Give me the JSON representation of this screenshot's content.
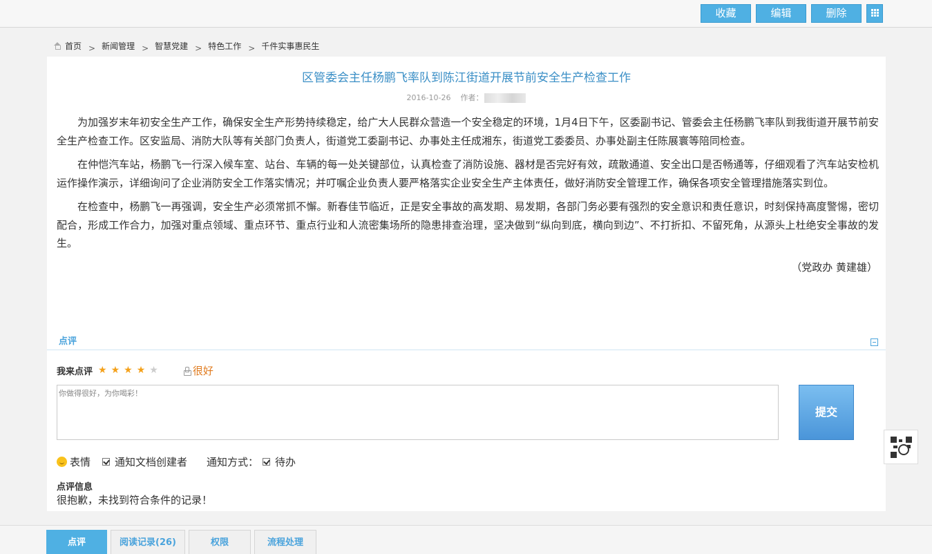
{
  "toolbar": {
    "favorite_label": "收藏",
    "edit_label": "编辑",
    "delete_label": "删除",
    "color_accent": "#4fb0e3"
  },
  "breadcrumb": {
    "items": [
      "首页",
      "新闻管理",
      "智慧党建",
      "特色工作",
      "千件实事惠民生"
    ],
    "separator": ">"
  },
  "article": {
    "title": "区管委会主任杨鹏飞率队到陈江街道开展节前安全生产检查工作",
    "date": "2016-10-26",
    "author_label": "作者：",
    "paragraphs": [
      "为加强岁末年初安全生产工作，确保安全生产形势持续稳定，给广大人民群众营造一个安全稳定的环境，1月4日下午，区委副书记、管委会主任杨鹏飞率队到我街道开展节前安全生产检查工作。区安监局、消防大队等有关部门负责人，街道党工委副书记、办事处主任成湘东，街道党工委委员、办事处副主任陈展寰等陪同检查。",
      "在仲恺汽车站，杨鹏飞一行深入候车室、站台、车辆的每一处关键部位，认真检查了消防设施、器材是否完好有效，疏散通道、安全出口是否畅通等，仔细观看了汽车站安检机运作操作演示，详细询问了企业消防安全工作落实情况；并叮嘱企业负责人要严格落实企业安全生产主体责任，做好消防安全管理工作，确保各项安全管理措施落实到位。",
      "在检查中，杨鹏飞一再强调，安全生产必须常抓不懈。新春佳节临近，正是安全事故的高发期、易发期，各部门务必要有强烈的安全意识和责任意识，时刻保持高度警惕，密切配合，形成工作合力，加强对重点领域、重点环节、重点行业和人流密集场所的隐患排查治理，坚决做到“纵向到底，横向到边”、不打折扣、不留死角，从源头上杜绝安全事故的发生。"
    ],
    "signature": "（党政办 黄建雄）"
  },
  "comment": {
    "section_label": "点评",
    "rate_label": "我来点评",
    "rating": 4,
    "rating_max": 5,
    "rating_text": "很好",
    "textarea_value": "你做得很好，为你喝彩！",
    "submit_label": "提交",
    "emoji_label": "表情",
    "notify_creator_label": "通知文档创建者",
    "notify_creator_checked": true,
    "notify_method_label": "通知方式：",
    "notify_todo_label": "待办",
    "notify_todo_checked": true,
    "info_label": "点评信息",
    "info_text": "很抱歉，未找到符合条件的记录！"
  },
  "bottom_tabs": [
    {
      "label": "点评",
      "active": true
    },
    {
      "label": "阅读记录(26)",
      "active": false
    },
    {
      "label": "权限",
      "active": false
    },
    {
      "label": "流程处理",
      "active": false
    }
  ]
}
